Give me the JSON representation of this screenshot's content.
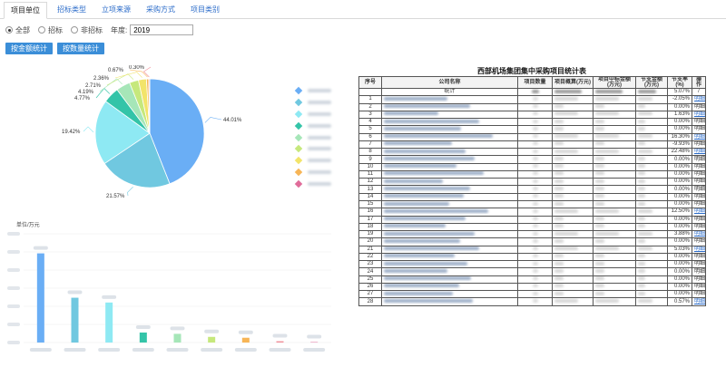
{
  "tabs": [
    "项目单位",
    "招标类型",
    "立项来源",
    "采购方式",
    "项目类别"
  ],
  "active_tab": 0,
  "filters": {
    "options": [
      "全部",
      "招标",
      "非招标"
    ],
    "selected": 0,
    "year_label": "年度:",
    "year_value": "2019"
  },
  "buttons": {
    "by_amount": "按金额统计",
    "by_count": "按数量统计"
  },
  "pie": {
    "slices": [
      {
        "pct": 44.01,
        "label": "44.01%",
        "color": "#6aaef5"
      },
      {
        "pct": 21.57,
        "label": "21.57%",
        "color": "#70c8e0"
      },
      {
        "pct": 19.42,
        "label": "19.42%",
        "color": "#8ee9f3"
      },
      {
        "pct": 4.77,
        "label": "4.77%",
        "color": "#34c4a8"
      },
      {
        "pct": 4.19,
        "label": "4.19%",
        "color": "#a6e6b8"
      },
      {
        "pct": 2.71,
        "label": "2.71%",
        "color": "#c6e87c"
      },
      {
        "pct": 2.36,
        "label": "2.36%",
        "color": "#f2e46a"
      },
      {
        "pct": 0.67,
        "label": "0.67%",
        "color": "#f7b556"
      },
      {
        "pct": 0.3,
        "label": "0.30%",
        "color": "#f08f9a"
      }
    ],
    "legend_colors": [
      "#6aaef5",
      "#70c8e0",
      "#8ee9f3",
      "#34c4a8",
      "#a6e6b8",
      "#c6e87c",
      "#f2e46a",
      "#f7b556",
      "#e06c9a"
    ]
  },
  "chart_data": {
    "type": "bar",
    "title": "",
    "unit_label": "单位/万元",
    "values": [
      205,
      103,
      92,
      23,
      20,
      13,
      11,
      3,
      1
    ],
    "colors": [
      "#6aaef5",
      "#70c8e0",
      "#8ee9f3",
      "#34c4a8",
      "#a6e6b8",
      "#c6e87c",
      "#f7b556",
      "#f08f9a",
      "#e06c9a"
    ],
    "ylim": [
      0,
      250
    ],
    "grid": true
  },
  "table": {
    "title": "西部机场集团集中采购项目统计表",
    "headers": [
      "序号",
      "公司名称",
      "项目数量",
      "项目概算(万元)",
      "项目中标金额(万元)",
      "节支金额(万元)",
      "节支率(%)",
      "操作"
    ],
    "total_label": "统计",
    "total_rate": "5.07%",
    "total_op": "/",
    "rows": [
      {
        "n": "1",
        "rate": "-2.05%",
        "op": "明细",
        "link": true
      },
      {
        "n": "2",
        "rate": "0.00%",
        "op": "明细",
        "link": false
      },
      {
        "n": "3",
        "rate": "1.63%",
        "op": "明细",
        "link": true
      },
      {
        "n": "4",
        "rate": "0.00%",
        "op": "明细",
        "link": false
      },
      {
        "n": "5",
        "rate": "0.00%",
        "op": "明细",
        "link": false
      },
      {
        "n": "6",
        "rate": "16.30%",
        "op": "明细",
        "link": true
      },
      {
        "n": "7",
        "rate": "-9.93%",
        "op": "明细",
        "link": false
      },
      {
        "n": "8",
        "rate": "22.48%",
        "op": "明细",
        "link": true
      },
      {
        "n": "9",
        "rate": "0.00%",
        "op": "明细",
        "link": false
      },
      {
        "n": "10",
        "rate": "0.00%",
        "op": "明细",
        "link": false
      },
      {
        "n": "11",
        "rate": "0.00%",
        "op": "明细",
        "link": false
      },
      {
        "n": "12",
        "rate": "0.00%",
        "op": "明细",
        "link": false
      },
      {
        "n": "13",
        "rate": "0.00%",
        "op": "明细",
        "link": false
      },
      {
        "n": "14",
        "rate": "0.00%",
        "op": "明细",
        "link": false
      },
      {
        "n": "15",
        "rate": "0.00%",
        "op": "明细",
        "link": false
      },
      {
        "n": "16",
        "rate": "12.50%",
        "op": "明细",
        "link": true
      },
      {
        "n": "17",
        "rate": "0.00%",
        "op": "明细",
        "link": false
      },
      {
        "n": "18",
        "rate": "0.00%",
        "op": "明细",
        "link": false
      },
      {
        "n": "19",
        "rate": "3.88%",
        "op": "明细",
        "link": true
      },
      {
        "n": "20",
        "rate": "0.00%",
        "op": "明细",
        "link": false
      },
      {
        "n": "21",
        "rate": "5.03%",
        "op": "明细",
        "link": true
      },
      {
        "n": "22",
        "rate": "0.00%",
        "op": "明细",
        "link": false
      },
      {
        "n": "23",
        "rate": "0.00%",
        "op": "明细",
        "link": false
      },
      {
        "n": "24",
        "rate": "0.00%",
        "op": "明细",
        "link": false
      },
      {
        "n": "25",
        "rate": "0.00%",
        "op": "明细",
        "link": false
      },
      {
        "n": "26",
        "rate": "0.00%",
        "op": "明细",
        "link": false
      },
      {
        "n": "27",
        "rate": "0.00%",
        "op": "明细",
        "link": false
      },
      {
        "n": "28",
        "rate": "0.57%",
        "op": "明细",
        "link": true
      }
    ]
  }
}
